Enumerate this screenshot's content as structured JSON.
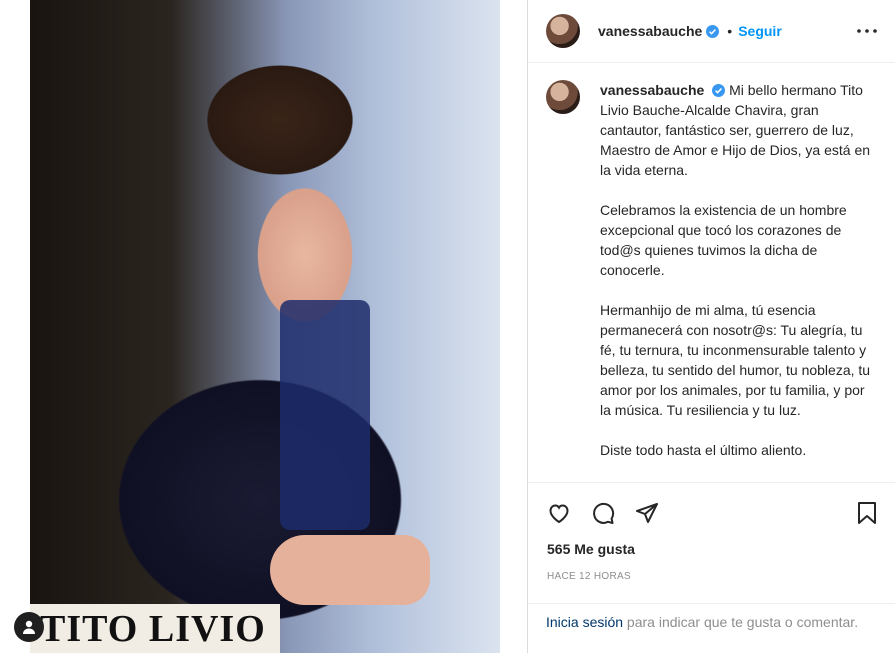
{
  "photo": {
    "caption": "TITO LIVIO"
  },
  "header": {
    "username": "vanessabauche",
    "separator": "•",
    "follow_label": "Seguir"
  },
  "caption": {
    "username": "vanessabauche",
    "paragraphs": [
      "Mi bello hermano Tito Livio Bauche-Alcalde Chavira, gran cantautor, fantástico ser, guerrero de luz, Maestro de Amor e Hijo de Dios, ya está en la vida eterna.",
      "Celebramos la existencia de un hombre excepcional que tocó los corazones de tod@s quienes tuvimos la dicha de conocerle.",
      "Hermanhijo de mi alma, tú esencia permanecerá con nosotr@s: Tu alegría, tu fé, tu ternura, tu inconmensurable talento y belleza, tu sentido del humor, tu nobleza, tu amor por los animales, por tu familia, y por la música. Tu resiliencia y tu luz.",
      "Diste todo hasta el último aliento."
    ]
  },
  "post": {
    "likes": "565 Me gusta",
    "timestamp": "HACE 12 HORAS"
  },
  "login": {
    "link": "Inicia sesión",
    "text": " para indicar que te gusta o comentar."
  },
  "colors": {
    "accent": "#0095f6",
    "verified": "#3897f0"
  }
}
